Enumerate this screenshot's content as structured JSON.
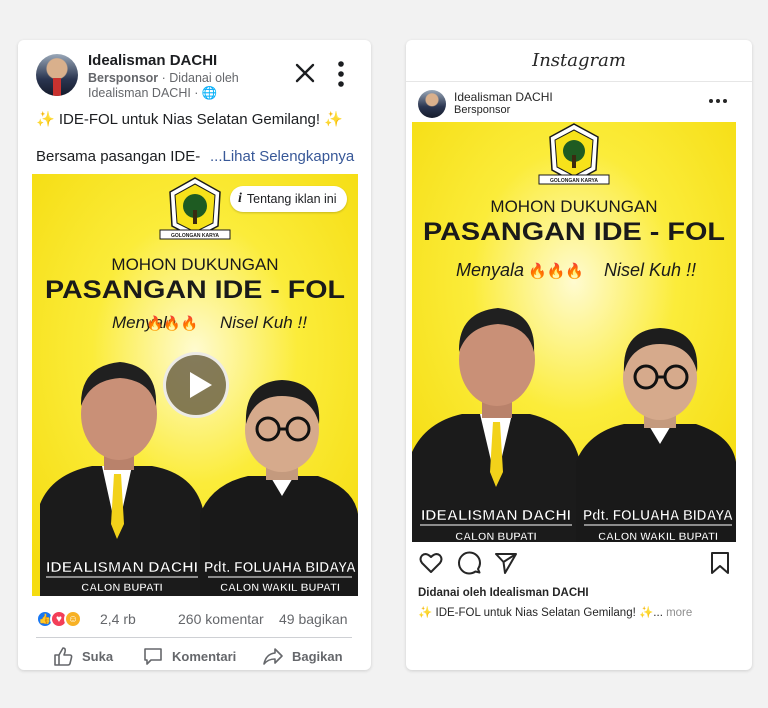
{
  "facebook": {
    "page_name": "Idealisman DACHI",
    "sponsored_label": "Bersponsor",
    "funded_by": " · Didanai oleh",
    "funder_line": "Idealisman DACHI · 🌐",
    "headline": "✨ IDE-FOL untuk Nias Selatan Gemilang! ✨",
    "body_text": "Bersama pasangan IDE-",
    "see_more": "...Lihat Selengkapnya",
    "about_ad": "Tentang iklan ini",
    "reaction_count": "2,4 rb",
    "comments": "260 komentar",
    "shares": "49 bagikan",
    "actions": [
      "Suka",
      "Komentari",
      "Bagikan"
    ]
  },
  "ad_creative": {
    "party_label": "GOLONGAN KARYA",
    "line1": "MOHON DUKUNGAN",
    "line2": "PASANGAN IDE - FOL",
    "slogan_a": "Menyala",
    "flames": "🔥🔥🔥",
    "slogan_b": "Nisel Kuh !!",
    "candidate1_name": "IDEALISMAN DACHI",
    "candidate1_role": "CALON BUPATI",
    "candidate2_name": "Pdt. FOLUAHA BIDAYA",
    "candidate2_role": "CALON WAKIL BUPATI"
  },
  "instagram": {
    "app_title": "Instagram",
    "account_name": "Idealisman DACHI",
    "sponsored_label": "Bersponsor",
    "funded_by": "Didanai oleh Idealisman DACHI",
    "caption": "✨ IDE-FOL untuk Nias Selatan Gemilang! ✨...",
    "more": " more"
  },
  "colors": {
    "fb_blue": "#1877f2",
    "fb_link": "#385898",
    "ad_yellow": "#f7e21a",
    "text_dark": "#1c1e21",
    "text_muted": "#65676b"
  }
}
